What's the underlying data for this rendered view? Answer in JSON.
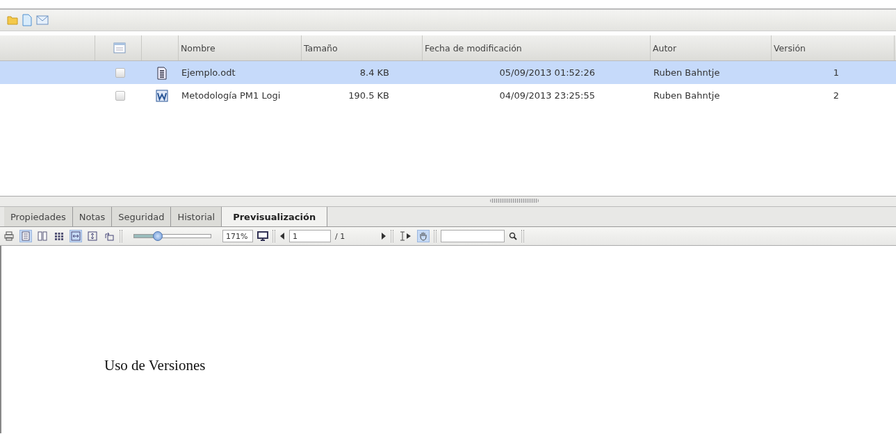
{
  "toolbar": {
    "buttons": [
      {
        "kind": "folder"
      },
      {
        "kind": "document"
      },
      {
        "kind": "mail"
      }
    ]
  },
  "table": {
    "columns": [
      "Nombre",
      "Tamaño",
      "Fecha de modificación",
      "Autor",
      "Versión"
    ],
    "rows": [
      {
        "selected": true,
        "checked": false,
        "kind": "odt",
        "cells": [
          "Ejemplo.odt",
          "8.4 KB",
          "05/09/2013 01:52:26",
          "Ruben Bahntje",
          "1"
        ]
      },
      {
        "selected": false,
        "checked": false,
        "kind": "word",
        "cells": [
          "Metodología PM1 Logi",
          "190.5 KB",
          "04/09/2013 23:25:55",
          "Ruben Bahntje",
          "2"
        ]
      }
    ]
  },
  "tabs": [
    {
      "label": "Propiedades",
      "selected": false
    },
    {
      "label": "Notas",
      "selected": false
    },
    {
      "label": "Seguridad",
      "selected": false
    },
    {
      "label": "Historial",
      "selected": false
    },
    {
      "label": "Previsualización",
      "selected": true
    }
  ],
  "viewer": {
    "tools": [
      {
        "kind": "print",
        "active": false
      },
      {
        "kind": "single",
        "active": true
      },
      {
        "kind": "double",
        "active": false
      },
      {
        "kind": "grid",
        "active": false
      },
      {
        "kind": "fitwidth",
        "active": true
      },
      {
        "kind": "fitheight",
        "active": false
      },
      {
        "kind": "rotate",
        "active": false
      }
    ],
    "zoom": {
      "level": 0.3,
      "value": "171%"
    },
    "page": {
      "value": "1",
      "total": "/ 1"
    },
    "select_tool": {
      "active": false
    },
    "hand_tool": {
      "active": true
    },
    "document_text": "Uso de Versiones"
  }
}
